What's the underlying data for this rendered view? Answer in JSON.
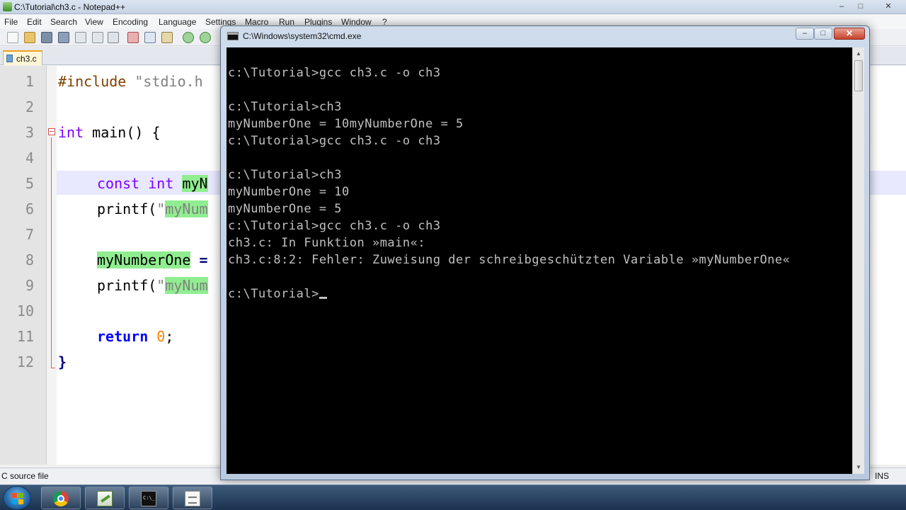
{
  "npp": {
    "title": "C:\\Tutorial\\ch3.c - Notepad++",
    "controls": {
      "minimize": "–",
      "maximize": "□",
      "close": "✕"
    },
    "menu": [
      "File",
      "Edit",
      "Search",
      "View",
      "Encoding",
      "Language",
      "Settings",
      "Macro",
      "Run",
      "Plugins",
      "Window",
      "?"
    ],
    "tab": {
      "label": "ch3.c"
    },
    "line_numbers": [
      "1",
      "2",
      "3",
      "4",
      "5",
      "6",
      "7",
      "8",
      "9",
      "10",
      "11",
      "12"
    ],
    "code": {
      "l1_pre": "#include",
      "l1_str": " \"stdio.h",
      "l3_kw": "int",
      "l3_rest": " main() {",
      "l5_const": "const",
      "l5_int": " int",
      "l5_var": "myN",
      "l6_fn": "printf(",
      "l6_str": "\"",
      "l6_hl": "myNum",
      "l8_var": "myNumberOne",
      "l8_op": " =",
      "l9_fn": "printf(",
      "l9_str": "\"",
      "l9_hl": "myNum",
      "l11_ret": "return",
      "l11_num": "0",
      "l11_end": ";",
      "l12": "}"
    },
    "status": {
      "left": "C source file",
      "right": "INS"
    }
  },
  "cmd": {
    "title": "C:\\Windows\\system32\\cmd.exe",
    "controls": {
      "minimize": "–",
      "maximize": "□",
      "close": "✕"
    },
    "lines": [
      "c:\\Tutorial>gcc ch3.c -o ch3",
      "",
      "c:\\Tutorial>ch3",
      "myNumberOne = 10myNumberOne = 5",
      "c:\\Tutorial>gcc ch3.c -o ch3",
      "",
      "c:\\Tutorial>ch3",
      "myNumberOne = 10",
      "myNumberOne = 5",
      "c:\\Tutorial>gcc ch3.c -o ch3",
      "ch3.c: In Funktion »main«:",
      "ch3.c:8:2: Fehler: Zuweisung der schreibgeschützten Variable »myNumberOne«",
      ""
    ],
    "prompt": "c:\\Tutorial>"
  },
  "colors": {
    "terminal_bg": "#000000",
    "terminal_fg": "#c0c0c0",
    "keyword": "#8000ff",
    "keyword_bold": "#0000ff",
    "highlight": "#90ee90",
    "number": "#ff8000"
  }
}
